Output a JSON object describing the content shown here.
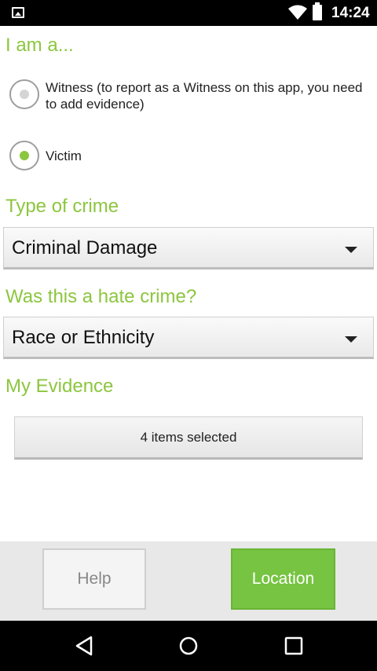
{
  "status_bar": {
    "time": "14:24"
  },
  "sections": {
    "role_title": "I am a...",
    "crime_title": "Type of crime",
    "hate_title": "Was this a hate crime?",
    "evidence_title": "My Evidence"
  },
  "role_options": [
    {
      "label": "Witness (to report as a Witness on this app, you need to add evidence)",
      "selected": false
    },
    {
      "label": "Victim",
      "selected": true
    }
  ],
  "crime_type": {
    "selected": "Criminal Damage"
  },
  "hate_crime": {
    "selected": "Race or Ethnicity"
  },
  "evidence": {
    "button_label": "4 items selected"
  },
  "bottom_bar": {
    "help_label": "Help",
    "location_label": "Location"
  },
  "colors": {
    "accent": "#8cc63f",
    "location_button": "#76c441"
  }
}
